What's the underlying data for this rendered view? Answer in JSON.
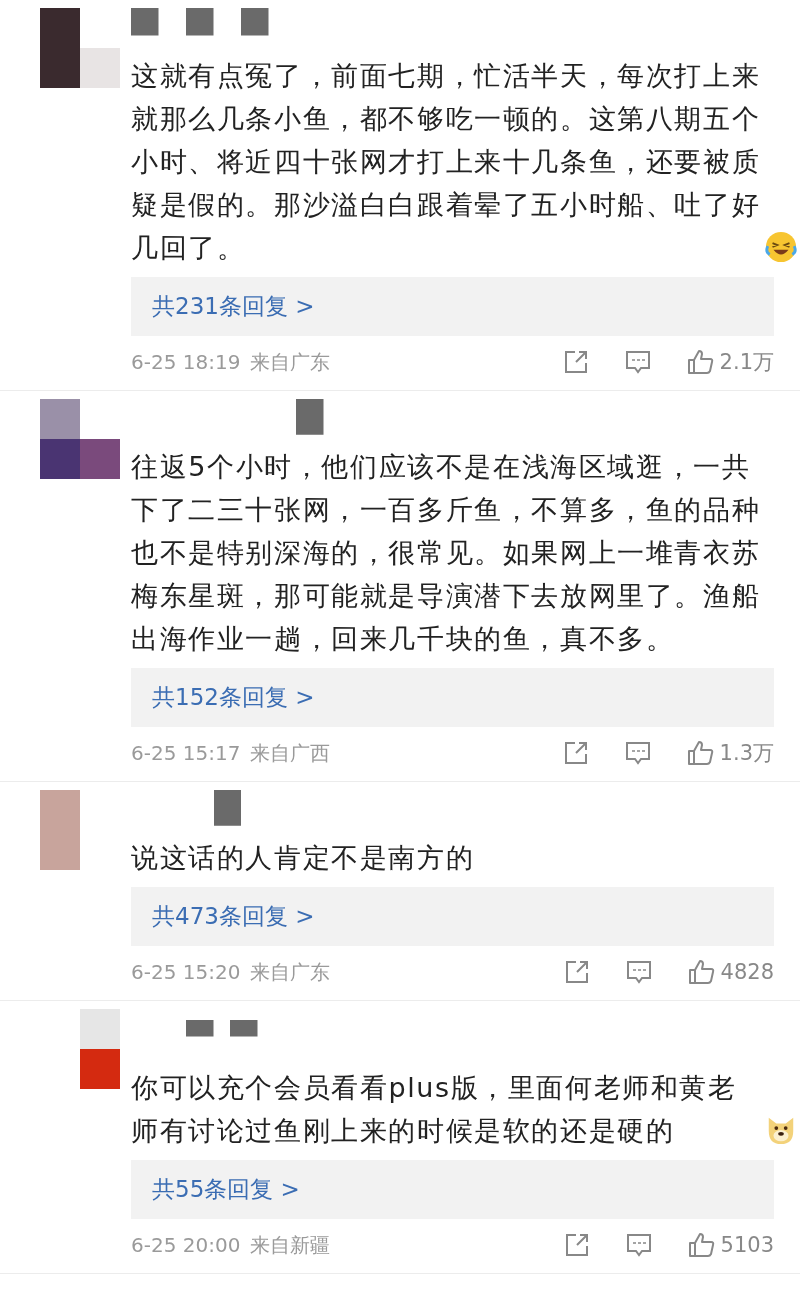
{
  "comments": [
    {
      "text": "这就有点冤了，前面七期，忙活半天，每次打上来就那么几条小鱼，都不够吃一顿的。这第八期五个小时、将近四十张网才打上来十几条鱼，还要被质疑是假的。那沙溢白白跟着晕了五小时船、吐了好几回了。",
      "emoji": {
        "kind": "laughing"
      },
      "replies": "共231条回复 >",
      "time": "6-25 18:19",
      "location": "来自广东",
      "likes": "2.1万"
    },
    {
      "text": "往返5个小时，他们应该不是在浅海区域逛，一共下了二三十张网，一百多斤鱼，不算多，鱼的品种也不是特别深海的，很常见。如果网上一堆青衣苏梅东星斑，那可能就是导演潜下去放网里了。渔船出海作业一趟，回来几千块的鱼，真不多。",
      "replies": "共152条回复 >",
      "time": "6-25 15:17",
      "location": "来自广西",
      "likes": "1.3万"
    },
    {
      "text": "说这话的人肯定不是南方的",
      "replies": "共473条回复 >",
      "time": "6-25 15:20",
      "location": "来自广东",
      "likes": "4828"
    },
    {
      "text": "你可以充个会员看看plus版，里面何老师和黄老师有讨论过鱼刚上来的时候是软的还是硬的",
      "emoji": {
        "kind": "dog"
      },
      "replies": "共55条回复 >",
      "time": "6-25 20:00",
      "location": "来自新疆",
      "likes": "5103"
    }
  ]
}
